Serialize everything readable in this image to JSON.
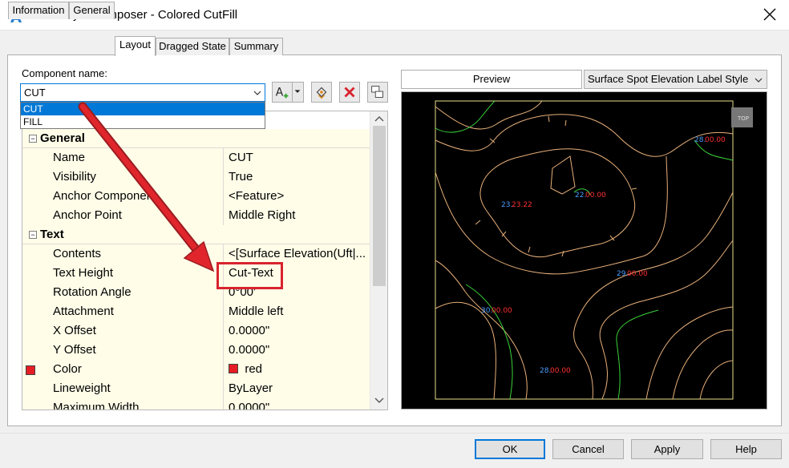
{
  "window": {
    "title": "Label Style Composer - Colored CutFill"
  },
  "tabs": [
    {
      "label": "Information"
    },
    {
      "label": "General"
    },
    {
      "label": "Layout"
    },
    {
      "label": "Dragged State"
    },
    {
      "label": "Summary"
    }
  ],
  "active_tab": "Layout",
  "component": {
    "label": "Component name:",
    "value": "CUT",
    "options": [
      "CUT",
      "FILL"
    ]
  },
  "toolbar": {
    "icons": [
      "add-text-component-icon",
      "dropdown-arrow-icon",
      "component-draw-order-icon",
      "delete-component-icon",
      "copy-component-icon"
    ]
  },
  "properties": {
    "general_label": "General",
    "general": [
      {
        "name": "Name",
        "value": "CUT"
      },
      {
        "name": "Visibility",
        "value": "True"
      },
      {
        "name": "Anchor Component",
        "value": "<Feature>"
      },
      {
        "name": "Anchor Point",
        "value": "Middle Right"
      }
    ],
    "text_label": "Text",
    "text": [
      {
        "name": "Contents",
        "value": "<[Surface Elevation(Uft|..."
      },
      {
        "name": "Text Height",
        "value": "Cut-Text"
      },
      {
        "name": "Rotation Angle",
        "value": "0°00'"
      },
      {
        "name": "Attachment",
        "value": "Middle left"
      },
      {
        "name": "X Offset",
        "value": "0.0000\""
      },
      {
        "name": "Y Offset",
        "value": "0.0000\""
      },
      {
        "name": "Color",
        "value": "red"
      },
      {
        "name": "Lineweight",
        "value": "ByLayer"
      },
      {
        "name": "Maximum Width",
        "value": "0.0000\""
      }
    ]
  },
  "preview": {
    "tab_label": "Preview",
    "style_value": "Surface Spot Elevation Label Style",
    "top_badge": "TOP",
    "labels": [
      {
        "cut": "28.",
        "fill": "00.00"
      },
      {
        "cut": "23.",
        "fill": "23.22"
      },
      {
        "cut": "22.",
        "fill": "00.00"
      },
      {
        "cut": "29.",
        "fill": "00.00"
      },
      {
        "cut": "30.",
        "fill": "00.00"
      },
      {
        "cut": "28.",
        "fill": "00.00"
      }
    ],
    "colors": {
      "cut": "#4a9cff",
      "fill": "#ff3030",
      "major": "#e8b07a",
      "minor": "#3bd23b",
      "border": "#e8e08a"
    }
  },
  "buttons": {
    "ok": "OK",
    "cancel": "Cancel",
    "apply": "Apply",
    "help": "Help"
  },
  "colors": {
    "accent": "#0078d7",
    "annotation": "#d9232e",
    "swatch_red": "#e51c23"
  }
}
